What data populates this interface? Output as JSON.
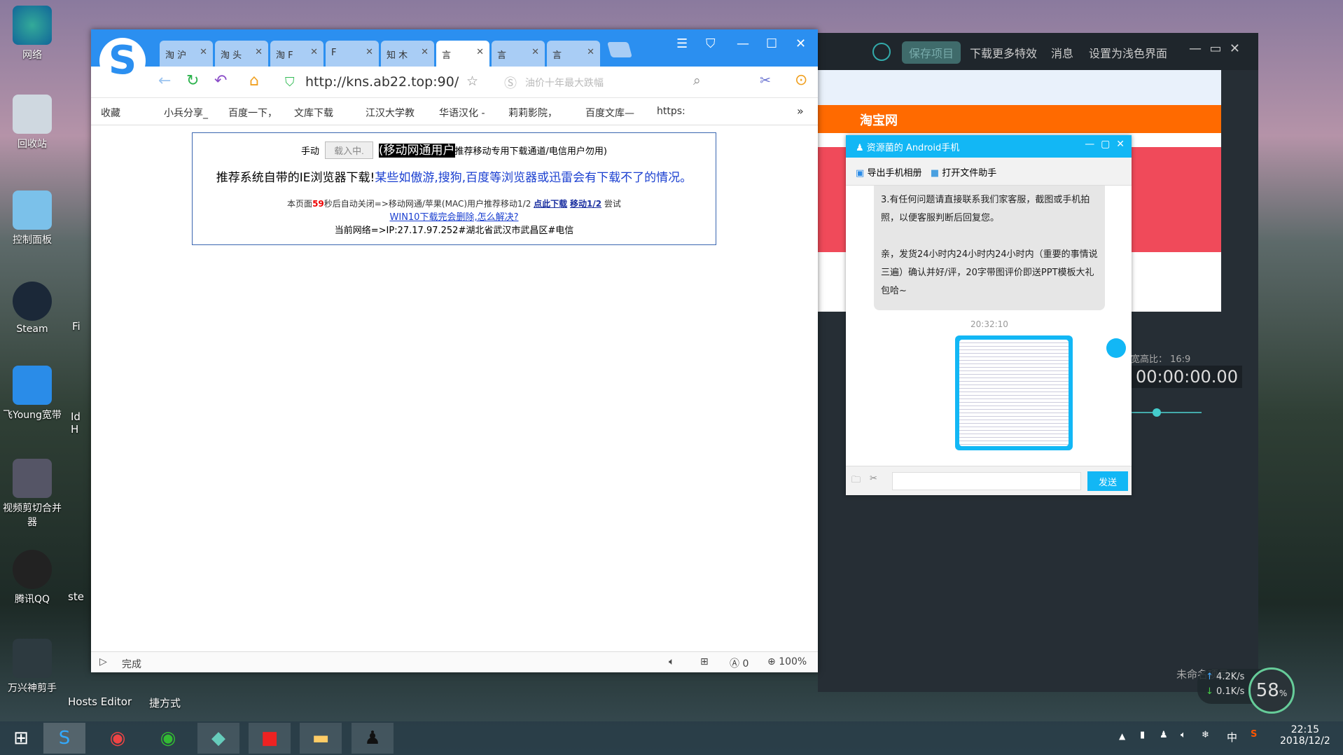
{
  "desktop": {
    "icons": [
      "网络",
      "回收站",
      "控制面板",
      "Steam",
      "飞Young宽带",
      "视频剪切合并器",
      "腾讯QQ",
      "万兴神剪手"
    ],
    "partial": [
      "Fi",
      "Id H",
      "ste",
      "Hosts Editor",
      "捷方式"
    ]
  },
  "browser": {
    "tabs": [
      "淘 沪",
      "淘 头",
      "淘 F",
      "F",
      "知 木",
      "言",
      "言",
      "言"
    ],
    "url": "http://kns.ab22.top:90/",
    "search_placeholder": "油价十年最大跌幅",
    "bookmarks": [
      "收藏",
      "小兵分享_",
      "百度一下，",
      "文库下载",
      "江汉大学教",
      "华语汉化 -",
      "莉莉影院，",
      "百度文库—",
      "https:"
    ],
    "more": "»",
    "page": {
      "manual": "手动",
      "loading_button": "载入中.",
      "mobile_users": "(移动网通用户",
      "mobile_note": "推荐移动专用下载通道/电信用户勿用)",
      "recommend_black": "推荐系统自带的IE浏览器下载!",
      "recommend_blue": "某些如傲游,搜狗,百度等浏览器或迅雷会有下载不了的情况。",
      "countdown_pre": "本页面",
      "countdown": "59",
      "countdown_post": "秒后自动关闭=>移动网通/苹果(MAC)用户推荐移动1/2",
      "link_download": "点此下载",
      "link_mobile": "移动1/2",
      "try": "尝试",
      "win10_link": "WIN10下载完会删除,怎么解决?",
      "network": "当前网络=>IP:27.17.97.252#湖北省武汉市武昌区#电信"
    },
    "status": {
      "text": "完成",
      "ad_count": "0",
      "zoom": "100%"
    }
  },
  "filmora": {
    "menu": [
      "保存项目",
      "下载更多特效",
      "消息",
      "设置为浅色界面"
    ],
    "aspect": "宽高比： 16:9",
    "timecode": "00:00:00.00",
    "project": "未命名项目 *"
  },
  "qq": {
    "title": "资源菌的 Android手机",
    "export": "导出手机相册",
    "open_helper": "打开文件助手",
    "msg1": "3.有任何问题请直接联系我们家客服，截图或手机拍照，以便客服判断后回复您。",
    "msg2": "亲，发货24小时内24小时内24小时内（重要的事情说三遍）确认并好/评，20字带图评价即送PPT模板大礼包哈~",
    "time": "20:32:10",
    "send": "发送"
  },
  "netmon": {
    "up": "4.2K/s",
    "down": "0.1K/s",
    "percent": "58",
    "unit": "%"
  },
  "tray": {
    "ime": "中",
    "time": "22:15",
    "date": "2018/12/2"
  }
}
